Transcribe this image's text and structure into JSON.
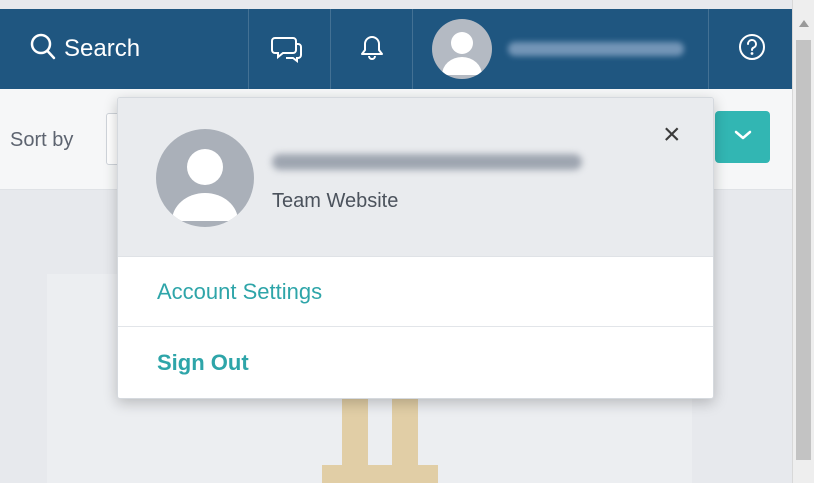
{
  "topbar": {
    "search_label": "Search",
    "icons": [
      "search-icon",
      "chat-icon",
      "bell-icon",
      "avatar",
      "help-icon"
    ]
  },
  "toolbar": {
    "sort_label": "Sort by"
  },
  "user_menu": {
    "team_label": "Team Website",
    "close_label": "×",
    "items": [
      {
        "label": "Account Settings"
      },
      {
        "label": "Sign Out"
      }
    ]
  },
  "colors": {
    "topbar_bg": "#1f5680",
    "accent": "#2ea5a9",
    "teal_button": "#32b6b3"
  }
}
